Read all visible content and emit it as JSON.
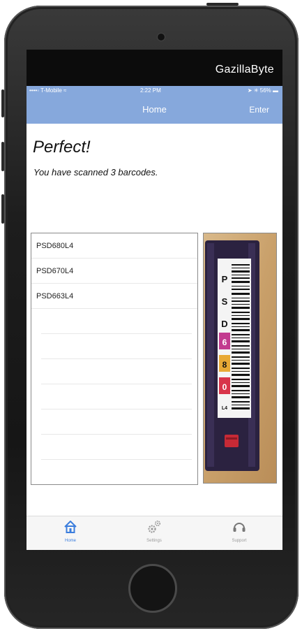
{
  "brand": "GazillaByte",
  "status_bar": {
    "carrier": "••••◦ T-Mobile ≈",
    "time": "2:22 PM",
    "battery": "➤ ✳ 56% ▬"
  },
  "nav": {
    "title": "Home",
    "enter": "Enter"
  },
  "headline": "Perfect!",
  "subline": "You have scanned 3 barcodes.",
  "barcodes": [
    "PSD680L4",
    "PSD670L4",
    "PSD663L4"
  ],
  "tape_label": {
    "chars": [
      "P",
      "S",
      "D",
      "6",
      "8",
      "0",
      "L4"
    ]
  },
  "tabs": [
    {
      "label": "Home",
      "icon": "home-icon",
      "active": true
    },
    {
      "label": "Settings",
      "icon": "gears-icon",
      "active": false
    },
    {
      "label": "Support",
      "icon": "headset-icon",
      "active": false
    }
  ],
  "colors": {
    "nav": "#86a8dc",
    "active_tab": "#3b7ddd",
    "brand_bar": "#0c0c0c"
  }
}
